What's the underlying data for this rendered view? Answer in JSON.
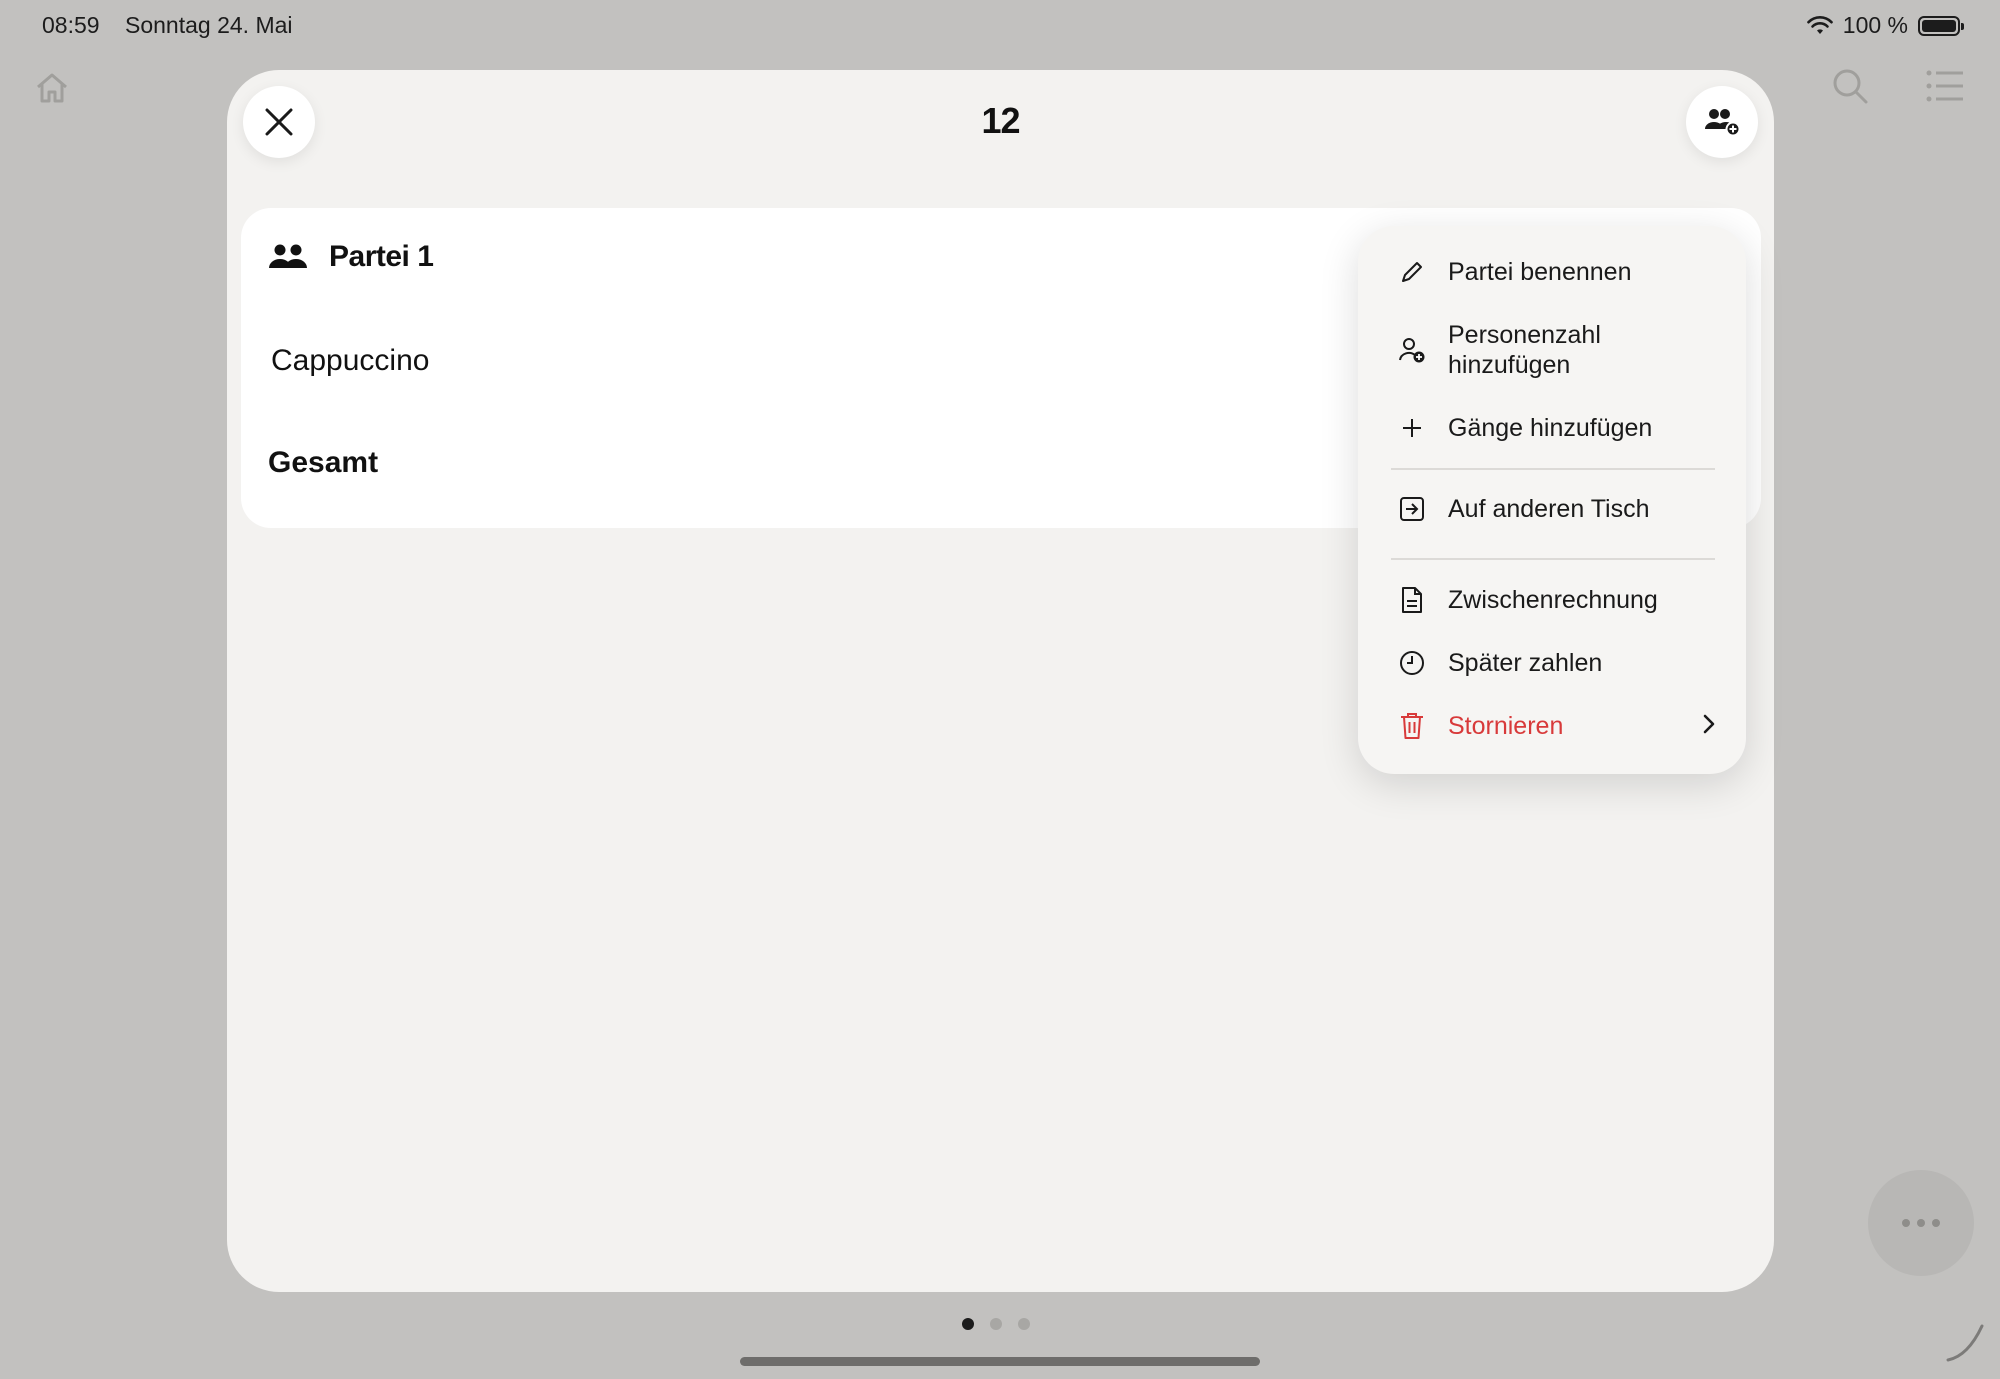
{
  "status_bar": {
    "time": "08:59",
    "date": "Sonntag 24. Mai",
    "battery": "100 %"
  },
  "modal": {
    "title": "12",
    "close_icon": "close-icon",
    "add_party_icon": "add-group-icon"
  },
  "party": {
    "name": "Partei 1",
    "items": [
      {
        "name": "Cappuccino"
      }
    ],
    "total_label": "Gesamt"
  },
  "menu": {
    "items": [
      {
        "label": "Partei benennen",
        "icon": "pencil-icon"
      },
      {
        "label": "Personenzahl hinzufügen",
        "line1": "Personenzahl",
        "line2": "hinzufügen",
        "icon": "add-person-icon"
      },
      {
        "label": "Gänge hinzufügen",
        "icon": "plus-icon"
      },
      {
        "label": "Auf anderen Tisch",
        "icon": "move-table-icon"
      },
      {
        "label": "Zwischenrechnung",
        "icon": "document-icon"
      },
      {
        "label": "Später zahlen",
        "icon": "clock-icon"
      },
      {
        "label": "Stornieren",
        "icon": "trash-icon",
        "color": "#d83a3a"
      }
    ]
  },
  "pagination": {
    "pages": 3,
    "active": 1
  }
}
